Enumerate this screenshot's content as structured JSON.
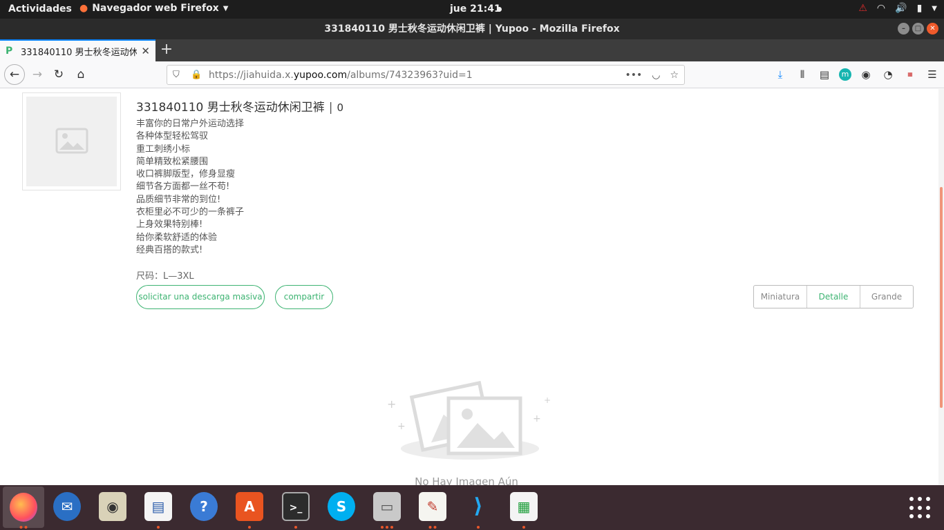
{
  "topbar": {
    "activities": "Actividades",
    "app_menu": "Navegador web Firefox",
    "clock": "jue 21:41"
  },
  "window": {
    "title": "331840110 男士秋冬运动休闲卫裤 | Yupoo - Mozilla Firefox"
  },
  "tab": {
    "title": "331840110 男士秋冬运动休闲卫裤 | Yupoo"
  },
  "urlbar": {
    "prefix": "https://jiahuida.x.",
    "domain": "yupoo.com",
    "path": "/albums/74323963?uid=1"
  },
  "album": {
    "title": "331840110 男士秋冬运动休闲卫裤",
    "separator": "|",
    "count": "0",
    "description": [
      "丰富你的日常户外运动选择",
      "各种体型轻松驾驭",
      "重工刺绣小标",
      "简单精致松紧腰围",
      "收口裤脚版型，修身显瘦",
      "细节各方面都一丝不苟!",
      "品质细节非常的到位!",
      "衣柜里必不可少的一条裤子",
      "上身效果特别棒!",
      "给你柔软舒适的体验",
      "经典百搭的款式!"
    ],
    "size": "尺码：L—3XL",
    "bulk_download_label": "solicitar una descarga masiva",
    "share_label": "compartir"
  },
  "view_modes": {
    "options": [
      "Miniatura",
      "Detalle",
      "Grande"
    ],
    "selected": "Detalle"
  },
  "empty_state": {
    "text": "No Hay Imagen Aún"
  },
  "colors": {
    "accent": "#3cb371",
    "dock": "#3b2a30",
    "scrollbar_thumb": "#f0957a"
  }
}
